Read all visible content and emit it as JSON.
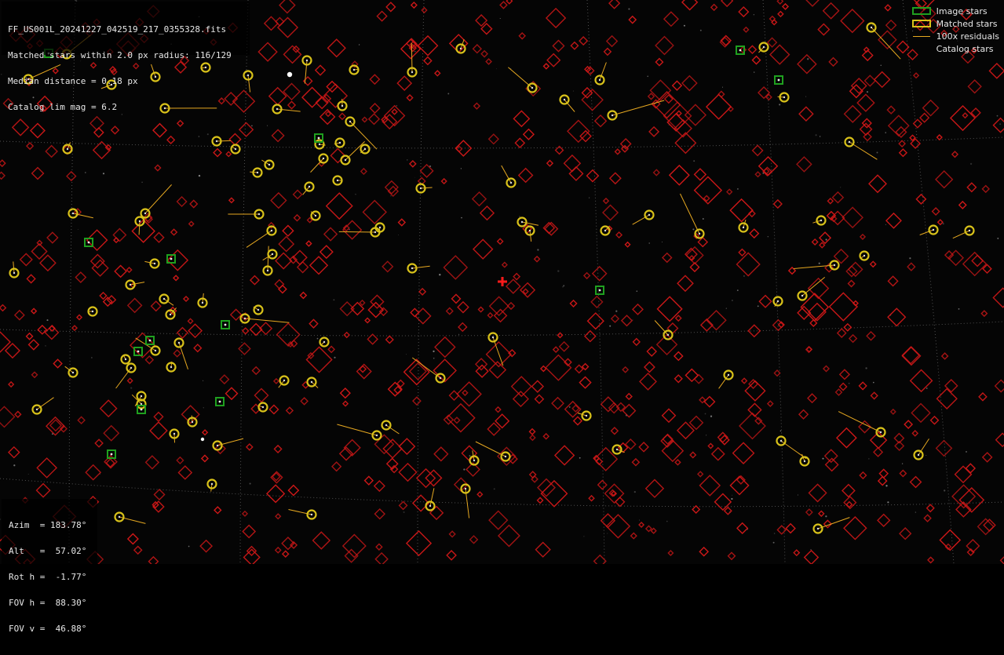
{
  "header": {
    "lines": [
      "FF_US001L_20241227_042519_217_0355328.fits",
      "Matched stars within 2.0 px radius: 116/129",
      "Median distance = 0.18 px",
      "Catalog lim mag = 6.2"
    ]
  },
  "pointing": {
    "lines": [
      "Azim  = 183.78°",
      "Alt   =  57.02°",
      "Rot h =  -1.77°",
      "FOV h =  88.30°",
      "FOV v =  46.88°"
    ]
  },
  "legend": {
    "image_stars": "Image stars",
    "matched_stars": "Matched stars",
    "residuals": "100x residuals",
    "catalog_stars": "Catalog stars"
  },
  "colors": {
    "background": "#050505",
    "image_star": "#1fa01f",
    "matched_star": "#d9c21a",
    "residual": "#e6a820",
    "catalog_star": "#d01818",
    "center_marker": "#ff1a1a",
    "grid": "#707070"
  }
}
